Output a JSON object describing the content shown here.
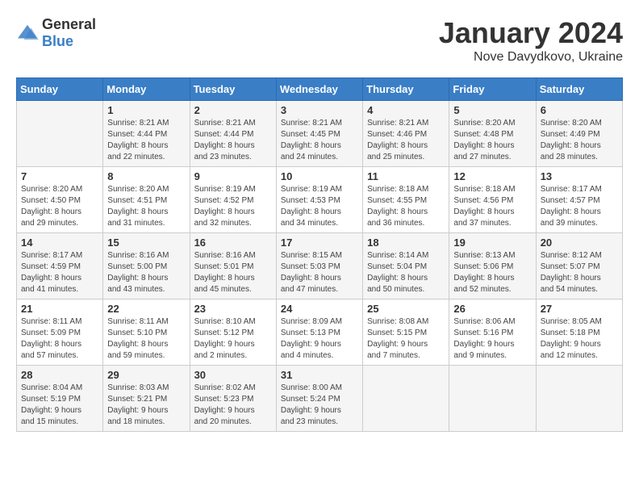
{
  "logo": {
    "general": "General",
    "blue": "Blue"
  },
  "header": {
    "month": "January 2024",
    "location": "Nove Davydkovo, Ukraine"
  },
  "days_of_week": [
    "Sunday",
    "Monday",
    "Tuesday",
    "Wednesday",
    "Thursday",
    "Friday",
    "Saturday"
  ],
  "weeks": [
    [
      {
        "day": "",
        "info": ""
      },
      {
        "day": "1",
        "info": "Sunrise: 8:21 AM\nSunset: 4:44 PM\nDaylight: 8 hours\nand 22 minutes."
      },
      {
        "day": "2",
        "info": "Sunrise: 8:21 AM\nSunset: 4:44 PM\nDaylight: 8 hours\nand 23 minutes."
      },
      {
        "day": "3",
        "info": "Sunrise: 8:21 AM\nSunset: 4:45 PM\nDaylight: 8 hours\nand 24 minutes."
      },
      {
        "day": "4",
        "info": "Sunrise: 8:21 AM\nSunset: 4:46 PM\nDaylight: 8 hours\nand 25 minutes."
      },
      {
        "day": "5",
        "info": "Sunrise: 8:20 AM\nSunset: 4:48 PM\nDaylight: 8 hours\nand 27 minutes."
      },
      {
        "day": "6",
        "info": "Sunrise: 8:20 AM\nSunset: 4:49 PM\nDaylight: 8 hours\nand 28 minutes."
      }
    ],
    [
      {
        "day": "7",
        "info": "Sunrise: 8:20 AM\nSunset: 4:50 PM\nDaylight: 8 hours\nand 29 minutes."
      },
      {
        "day": "8",
        "info": "Sunrise: 8:20 AM\nSunset: 4:51 PM\nDaylight: 8 hours\nand 31 minutes."
      },
      {
        "day": "9",
        "info": "Sunrise: 8:19 AM\nSunset: 4:52 PM\nDaylight: 8 hours\nand 32 minutes."
      },
      {
        "day": "10",
        "info": "Sunrise: 8:19 AM\nSunset: 4:53 PM\nDaylight: 8 hours\nand 34 minutes."
      },
      {
        "day": "11",
        "info": "Sunrise: 8:18 AM\nSunset: 4:55 PM\nDaylight: 8 hours\nand 36 minutes."
      },
      {
        "day": "12",
        "info": "Sunrise: 8:18 AM\nSunset: 4:56 PM\nDaylight: 8 hours\nand 37 minutes."
      },
      {
        "day": "13",
        "info": "Sunrise: 8:17 AM\nSunset: 4:57 PM\nDaylight: 8 hours\nand 39 minutes."
      }
    ],
    [
      {
        "day": "14",
        "info": "Sunrise: 8:17 AM\nSunset: 4:59 PM\nDaylight: 8 hours\nand 41 minutes."
      },
      {
        "day": "15",
        "info": "Sunrise: 8:16 AM\nSunset: 5:00 PM\nDaylight: 8 hours\nand 43 minutes."
      },
      {
        "day": "16",
        "info": "Sunrise: 8:16 AM\nSunset: 5:01 PM\nDaylight: 8 hours\nand 45 minutes."
      },
      {
        "day": "17",
        "info": "Sunrise: 8:15 AM\nSunset: 5:03 PM\nDaylight: 8 hours\nand 47 minutes."
      },
      {
        "day": "18",
        "info": "Sunrise: 8:14 AM\nSunset: 5:04 PM\nDaylight: 8 hours\nand 50 minutes."
      },
      {
        "day": "19",
        "info": "Sunrise: 8:13 AM\nSunset: 5:06 PM\nDaylight: 8 hours\nand 52 minutes."
      },
      {
        "day": "20",
        "info": "Sunrise: 8:12 AM\nSunset: 5:07 PM\nDaylight: 8 hours\nand 54 minutes."
      }
    ],
    [
      {
        "day": "21",
        "info": "Sunrise: 8:11 AM\nSunset: 5:09 PM\nDaylight: 8 hours\nand 57 minutes."
      },
      {
        "day": "22",
        "info": "Sunrise: 8:11 AM\nSunset: 5:10 PM\nDaylight: 8 hours\nand 59 minutes."
      },
      {
        "day": "23",
        "info": "Sunrise: 8:10 AM\nSunset: 5:12 PM\nDaylight: 9 hours\nand 2 minutes."
      },
      {
        "day": "24",
        "info": "Sunrise: 8:09 AM\nSunset: 5:13 PM\nDaylight: 9 hours\nand 4 minutes."
      },
      {
        "day": "25",
        "info": "Sunrise: 8:08 AM\nSunset: 5:15 PM\nDaylight: 9 hours\nand 7 minutes."
      },
      {
        "day": "26",
        "info": "Sunrise: 8:06 AM\nSunset: 5:16 PM\nDaylight: 9 hours\nand 9 minutes."
      },
      {
        "day": "27",
        "info": "Sunrise: 8:05 AM\nSunset: 5:18 PM\nDaylight: 9 hours\nand 12 minutes."
      }
    ],
    [
      {
        "day": "28",
        "info": "Sunrise: 8:04 AM\nSunset: 5:19 PM\nDaylight: 9 hours\nand 15 minutes."
      },
      {
        "day": "29",
        "info": "Sunrise: 8:03 AM\nSunset: 5:21 PM\nDaylight: 9 hours\nand 18 minutes."
      },
      {
        "day": "30",
        "info": "Sunrise: 8:02 AM\nSunset: 5:23 PM\nDaylight: 9 hours\nand 20 minutes."
      },
      {
        "day": "31",
        "info": "Sunrise: 8:00 AM\nSunset: 5:24 PM\nDaylight: 9 hours\nand 23 minutes."
      },
      {
        "day": "",
        "info": ""
      },
      {
        "day": "",
        "info": ""
      },
      {
        "day": "",
        "info": ""
      }
    ]
  ]
}
